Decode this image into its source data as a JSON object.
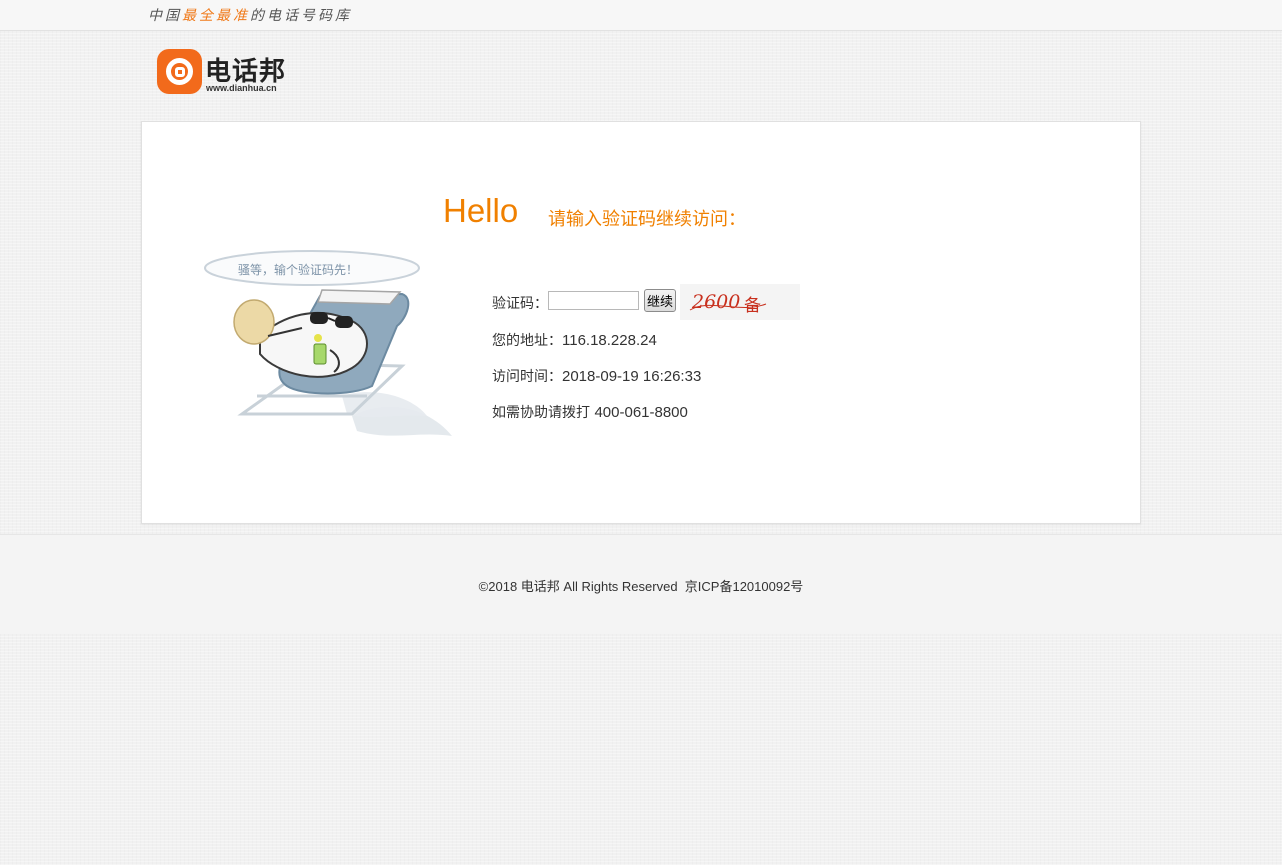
{
  "header": {
    "slogan_parts": [
      "中国",
      "最全最准",
      "的电话号码库"
    ],
    "accent_color": "#f07a1a"
  },
  "logo": {
    "name": "电话邦",
    "url": "www.dianhua.cn",
    "brand_color": "#f26a1b"
  },
  "main": {
    "hello": "Hello",
    "prompt": "请输入验证码继续访问：",
    "illustration_caption": "骚等，输个验证码先！",
    "captcha": {
      "label": "验证码：",
      "input_value": "",
      "input_placeholder": "",
      "button_label": "继续",
      "image_text": "2600 ",
      "image_glyph": "备"
    },
    "address_label": "您的地址：",
    "address_value": "116.18.228.24",
    "time_label": "访问时间：",
    "time_value": "2018-09-19 16:26:33",
    "help_label": "如需协助请拨打 ",
    "help_phone": "400-061-8800",
    "accent_color": "#f08000"
  },
  "footer": {
    "copyright": "©2018 电话邦 All Rights Reserved",
    "icp": "京ICP备12010092号"
  }
}
